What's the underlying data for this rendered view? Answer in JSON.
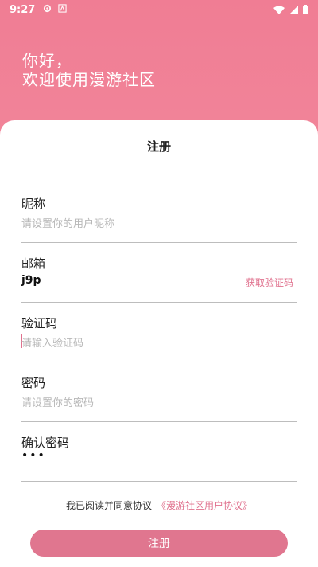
{
  "status_bar": {
    "time": "9:27",
    "icons": [
      "settings-icon",
      "text-icon",
      "wifi-icon",
      "signal-icon",
      "battery-icon"
    ]
  },
  "greeting": {
    "line1": "你好，",
    "line2": "欢迎使用漫游社区"
  },
  "form": {
    "title": "注册",
    "nickname": {
      "label": "昵称",
      "placeholder": "请设置你的用户昵称"
    },
    "email": {
      "label": "邮箱",
      "value": "j9p",
      "action": "获取验证码"
    },
    "code": {
      "label": "验证码",
      "placeholder": "请输入验证码"
    },
    "password": {
      "label": "密码",
      "placeholder": "请设置你的密码"
    },
    "confirm": {
      "label": "确认密码",
      "value": "•••"
    }
  },
  "agreement": {
    "text": "我已阅读并同意协议",
    "link": "《漫游社区用户协议》"
  },
  "submit_label": "注册",
  "colors": {
    "accent": "#e0768f",
    "header_gradient_top": "#f07d94",
    "header_gradient_bottom": "#f59aa8"
  }
}
